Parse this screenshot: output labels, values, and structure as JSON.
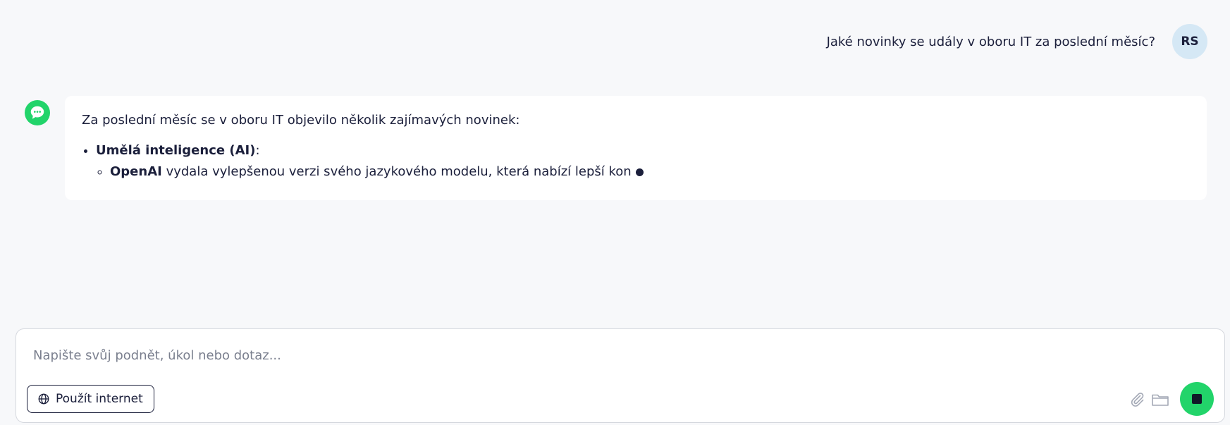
{
  "conversation": {
    "user_message": "Jaké novinky se udály v oboru IT za poslední měsíc?",
    "user_avatar_initials": "RS",
    "bot_response": {
      "intro": "Za poslední měsíc se v oboru IT objevilo několik zajímavých novinek:",
      "items": [
        {
          "title": "Umělá inteligence (AI)",
          "suffix": ":",
          "subitems": [
            {
              "bold": "OpenAI",
              "text": " vydala vylepšenou verzi svého jazykového modelu, která nabízí lepší kon"
            }
          ]
        }
      ]
    }
  },
  "composer": {
    "placeholder": "Napište svůj podnět, úkol nebo dotaz...",
    "value": "",
    "web_button_label": "Použít internet",
    "icons": [
      "globe-icon",
      "paperclip-icon",
      "folder-icon",
      "stop-icon"
    ]
  },
  "colors": {
    "accent_green": "#22d46a",
    "avatar_bg": "#d5e8f5",
    "background": "#f7f8fa",
    "text": "#1b1f3b"
  }
}
